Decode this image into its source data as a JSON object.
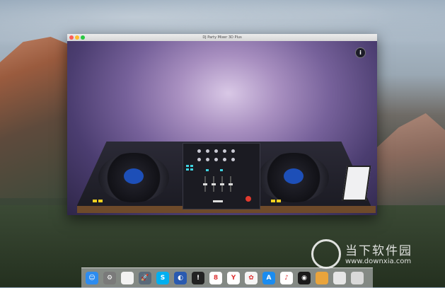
{
  "window": {
    "title": "DJ Party Mixer 3D Plus",
    "info_button": "i"
  },
  "dock": {
    "items": [
      {
        "icon": "finder-icon",
        "color": "#2d8cf0",
        "glyph": "☺"
      },
      {
        "icon": "system-preferences-icon",
        "color": "#7a7a7a",
        "glyph": "⚙"
      },
      {
        "icon": "document-icon",
        "color": "#f2f2f2",
        "glyph": ""
      },
      {
        "icon": "launchpad-icon",
        "color": "#5a6a7a",
        "glyph": "🚀"
      },
      {
        "icon": "skype-icon",
        "color": "#00aff0",
        "glyph": "S"
      },
      {
        "icon": "spotlight-icon",
        "color": "#2a5ab0",
        "glyph": "◐"
      },
      {
        "icon": "console-icon",
        "color": "#222222",
        "glyph": "!"
      },
      {
        "icon": "calendar-icon",
        "color": "#ffffff",
        "glyph": "8"
      },
      {
        "icon": "yandex-icon",
        "color": "#ffffff",
        "glyph": "Y"
      },
      {
        "icon": "photos-icon",
        "color": "#f5f5f5",
        "glyph": "✿"
      },
      {
        "icon": "app-store-icon",
        "color": "#1a8cf0",
        "glyph": "A"
      },
      {
        "icon": "itunes-icon",
        "color": "#ffffff",
        "glyph": "♪"
      },
      {
        "icon": "dj-mixer-icon",
        "color": "#1a1a1a",
        "glyph": "◉"
      },
      {
        "icon": "archive-icon",
        "color": "#e9a43c",
        "glyph": ""
      },
      {
        "icon": "browser-window-icon",
        "color": "#e6e6e6",
        "glyph": ""
      },
      {
        "icon": "trash-icon",
        "color": "#d9d9d9",
        "glyph": ""
      }
    ]
  },
  "watermark": {
    "cn": "当下软件园",
    "url": "www.downxia.com"
  },
  "colors": {
    "vinyl_label": "#1d4fb8",
    "accent_red": "#e23a2e",
    "cue_yellow": "#f0d020",
    "pad_cyan": "#3ed2e0"
  }
}
